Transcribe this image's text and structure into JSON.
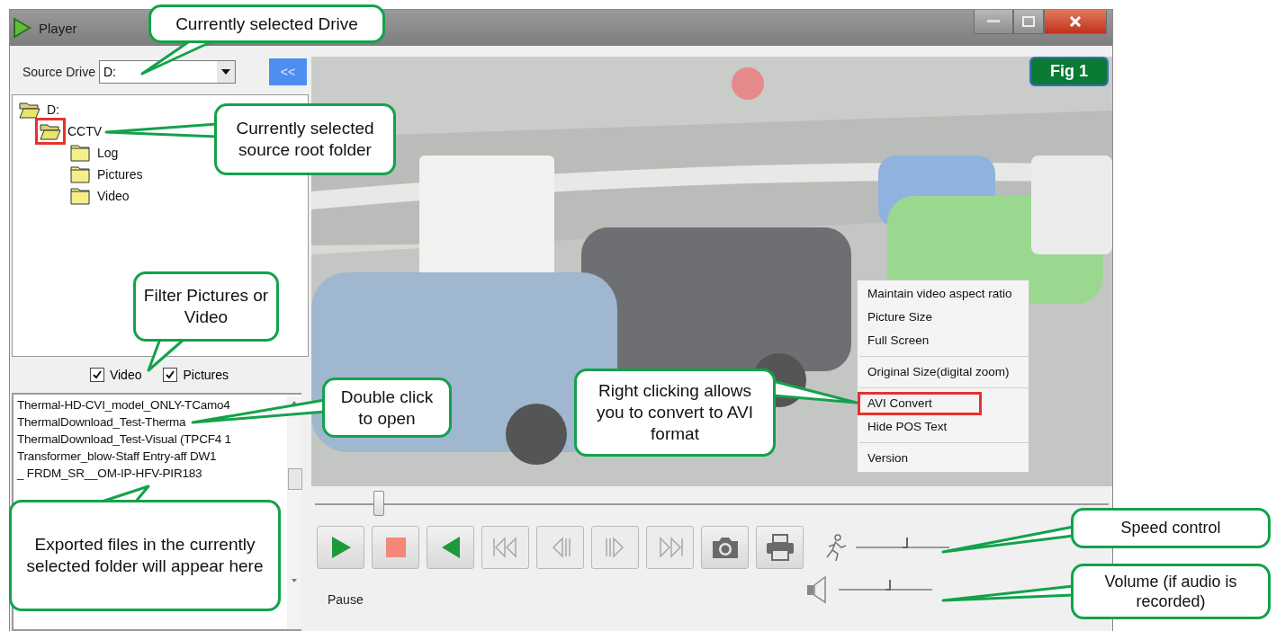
{
  "window": {
    "title": "Player"
  },
  "source_drive": {
    "label": "Source Drive",
    "value": "D:",
    "collapse_button": "<<"
  },
  "tree": [
    {
      "label": "D:",
      "expanded": true,
      "highlighted": false,
      "children": [
        {
          "label": "CCTV",
          "expanded": true,
          "highlighted": true,
          "children": [
            {
              "label": "Log",
              "expanded": false,
              "highlighted": false
            },
            {
              "label": "Pictures",
              "expanded": false,
              "highlighted": false
            },
            {
              "label": "Video",
              "expanded": false,
              "highlighted": false
            }
          ]
        }
      ]
    }
  ],
  "filters": [
    {
      "label": "Video",
      "checked": true
    },
    {
      "label": "Pictures",
      "checked": true
    }
  ],
  "files": [
    "Thermal-HD-CVI_model_ONLY-TCamo4",
    "ThermalDownload_Test-Therma",
    "ThermalDownload_Test-Visual (TPCF4 1",
    "Transformer_blow-Staff Entry-aff DW1",
    "_ FRDM_SR__OM-IP-HFV-PIR183"
  ],
  "video": {
    "badge": "Fig 1"
  },
  "context_menu": [
    {
      "label": "Maintain video aspect ratio",
      "highlighted": false,
      "separator_after": false
    },
    {
      "label": "Picture Size",
      "highlighted": false,
      "separator_after": false
    },
    {
      "label": "Full Screen",
      "highlighted": false,
      "separator_after": true
    },
    {
      "label": "Original Size(digital zoom)",
      "highlighted": false,
      "separator_after": true
    },
    {
      "label": "AVI Convert",
      "highlighted": true,
      "separator_after": false
    },
    {
      "label": "Hide POS Text",
      "highlighted": false,
      "separator_after": true
    },
    {
      "label": "Version",
      "highlighted": false,
      "separator_after": false
    }
  ],
  "seek": {
    "level": 0.08
  },
  "buttons": [
    {
      "kind": "play",
      "disabled": false
    },
    {
      "kind": "stop",
      "disabled": false
    },
    {
      "kind": "reverse",
      "disabled": false
    },
    {
      "kind": "first",
      "disabled": true
    },
    {
      "kind": "step_back",
      "disabled": true
    },
    {
      "kind": "step_forward",
      "disabled": true
    },
    {
      "kind": "last",
      "disabled": true
    },
    {
      "kind": "snapshot",
      "disabled": false
    },
    {
      "kind": "print",
      "disabled": false
    }
  ],
  "speed": {
    "level": 0.53
  },
  "volume": {
    "level": 0.53
  },
  "status": "Pause",
  "annotations": [
    {
      "text": "Currently selected Drive"
    },
    {
      "text": "Currently selected source root folder"
    },
    {
      "text": "Filter Pictures or Video"
    },
    {
      "text": "Double click to open"
    },
    {
      "text": "Exported files in the currently selected folder will appear here"
    },
    {
      "text": "Right clicking allows you to convert to AVI format"
    },
    {
      "text": "Speed control"
    },
    {
      "text": "Volume (if audio is recorded)"
    }
  ]
}
